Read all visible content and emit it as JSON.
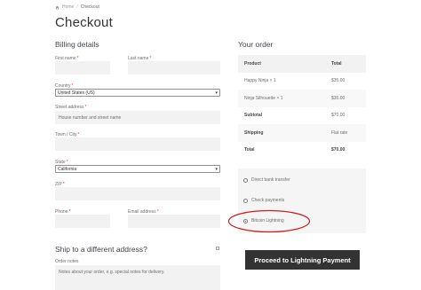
{
  "breadcrumb": {
    "home": "Home",
    "separator": "/",
    "current": "Checkout"
  },
  "page_title": "Checkout",
  "billing": {
    "title": "Billing details",
    "first_name_label": "First name",
    "last_name_label": "Last name",
    "required_mark": "*",
    "country_label": "Country",
    "country_value": "United States (US)",
    "street_label": "Street address",
    "street_placeholder": "House number and street name",
    "city_label": "Town / City",
    "state_label": "State",
    "state_value": "California",
    "zip_label": "ZIP",
    "phone_label": "Phone",
    "email_label": "Email address"
  },
  "order": {
    "title": "Your order",
    "col_product": "Product",
    "col_total": "Total",
    "items": [
      {
        "product": "Happy Ninja × 1",
        "total": "$35.00"
      },
      {
        "product": "Ninja Silhouette × 1",
        "total": "$35.00"
      }
    ],
    "subtotal_label": "Subtotal",
    "subtotal_value": "$70.00",
    "shipping_label": "Shipping",
    "shipping_value": "Flat rate",
    "total_label": "Total",
    "total_value": "$70.00"
  },
  "payment": {
    "options": [
      {
        "label": "Direct bank transfer",
        "selected": false
      },
      {
        "label": "Check payments",
        "selected": false
      },
      {
        "label": "Bitcoin Lightning",
        "selected": true
      }
    ],
    "highlight_color": "#cc1f1f",
    "proceed_label": "Proceed to Lightning Payment"
  },
  "shipping": {
    "title": "Ship to a different address?"
  },
  "notes": {
    "label": "Order notes",
    "placeholder": "Notes about your order, e.g. special notes for delivery."
  }
}
